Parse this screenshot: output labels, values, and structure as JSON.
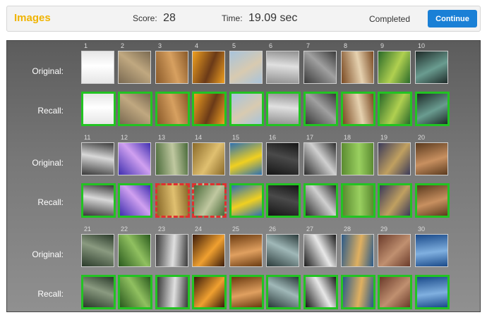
{
  "header": {
    "title": "Images",
    "score_label": "Score:",
    "score_value": "28",
    "time_label": "Time:",
    "time_value": "19.09 sec",
    "status": "Completed",
    "continue_label": "Continue"
  },
  "labels": {
    "original": "Original:",
    "recall": "Recall:"
  },
  "rows": [
    {
      "numbers": [
        "1",
        "2",
        "3",
        "4",
        "5",
        "6",
        "7",
        "8",
        "9",
        "10"
      ],
      "images": [
        {
          "name": "white-crumpled-paper",
          "c1": "#e6e6e6",
          "c2": "#ffffff"
        },
        {
          "name": "lion",
          "c1": "#7a6a52",
          "c2": "#c0a880"
        },
        {
          "name": "wheat-field",
          "c1": "#8a5a2a",
          "c2": "#d7a060"
        },
        {
          "name": "desert-sunset",
          "c1": "#f0a020",
          "c2": "#6b3a18"
        },
        {
          "name": "coastal-town",
          "c1": "#a8c4dc",
          "c2": "#d8cab0"
        },
        {
          "name": "duck-figurine",
          "c1": "#909090",
          "c2": "#e0e0e0"
        },
        {
          "name": "vintage-car",
          "c1": "#3a3a3a",
          "c2": "#a0a0a0"
        },
        {
          "name": "ornate-bazaar",
          "c1": "#7a4a22",
          "c2": "#e6d2b0"
        },
        {
          "name": "frog-figurines",
          "c1": "#2a6a2a",
          "c2": "#b0d050"
        },
        {
          "name": "teal-pattern",
          "c1": "#1e2a28",
          "c2": "#6a9c90"
        }
      ],
      "recall_wrong": []
    },
    {
      "numbers": [
        "11",
        "12",
        "13",
        "14",
        "15",
        "16",
        "17",
        "18",
        "19",
        "20"
      ],
      "images": [
        {
          "name": "hand-sculpture",
          "c1": "#3a3a3a",
          "c2": "#d8d8d8"
        },
        {
          "name": "neon-tunnel",
          "c1": "#4030b0",
          "c2": "#d0a0f0"
        },
        {
          "name": "forest-river",
          "c1": "#4a6a3a",
          "c2": "#c0c8a0"
        },
        {
          "name": "tea-jar",
          "c1": "#8a6a2a",
          "c2": "#e0c070"
        },
        {
          "name": "yellow-flowers",
          "c1": "#2e70b0",
          "c2": "#f0d020"
        },
        {
          "name": "black-cat",
          "c1": "#151515",
          "c2": "#4a4a4a"
        },
        {
          "name": "bw-portrait",
          "c1": "#2a2a2a",
          "c2": "#d0d0d0"
        },
        {
          "name": "green-dog",
          "c1": "#5a8a30",
          "c2": "#9ad060"
        },
        {
          "name": "mosaic",
          "c1": "#3a3a5a",
          "c2": "#c0a060"
        },
        {
          "name": "wagon-wheels",
          "c1": "#5a3a1e",
          "c2": "#c89060"
        }
      ],
      "recall_wrong": [
        2,
        3
      ]
    },
    {
      "numbers": [
        "21",
        "22",
        "23",
        "24",
        "25",
        "26",
        "27",
        "28",
        "29",
        "30"
      ],
      "images": [
        {
          "name": "circuit-board",
          "c1": "#2a3a2a",
          "c2": "#8a9a80"
        },
        {
          "name": "grass",
          "c1": "#2a5a1e",
          "c2": "#90c060"
        },
        {
          "name": "paper-roll",
          "c1": "#3a3a3a",
          "c2": "#e0e0e0"
        },
        {
          "name": "orange-jars",
          "c1": "#3a1a0a",
          "c2": "#f0a030"
        },
        {
          "name": "bread-loaves",
          "c1": "#6a3a10",
          "c2": "#e0a060"
        },
        {
          "name": "green-hills",
          "c1": "#2a3a3a",
          "c2": "#a0b8b8"
        },
        {
          "name": "sushi",
          "c1": "#181818",
          "c2": "#e8e8e8"
        },
        {
          "name": "food-platters",
          "c1": "#2a5a8a",
          "c2": "#e0b060"
        },
        {
          "name": "brick-building",
          "c1": "#6a3a2a",
          "c2": "#c09070"
        },
        {
          "name": "ocean-buoy",
          "c1": "#1a4a8a",
          "c2": "#80b0e0"
        }
      ],
      "recall_wrong": []
    }
  ]
}
